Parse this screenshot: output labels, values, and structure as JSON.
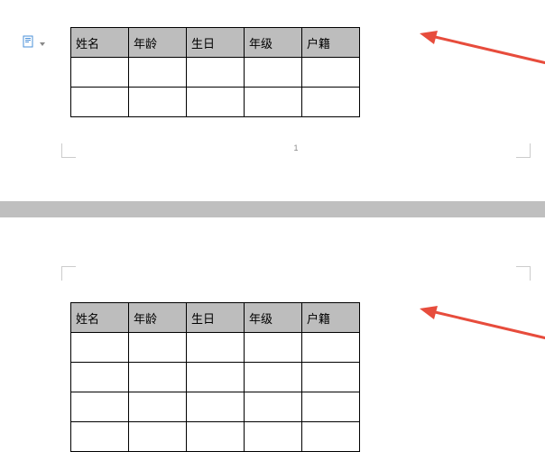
{
  "table1": {
    "headers": [
      "姓名",
      "年龄",
      "生日",
      "年级",
      "户籍"
    ]
  },
  "table2": {
    "headers": [
      "姓名",
      "年龄",
      "生日",
      "年级",
      "户籍"
    ]
  },
  "pageNumber1": "1",
  "colors": {
    "arrow": "#e74c3c",
    "headerBg": "#bdbdbd"
  }
}
